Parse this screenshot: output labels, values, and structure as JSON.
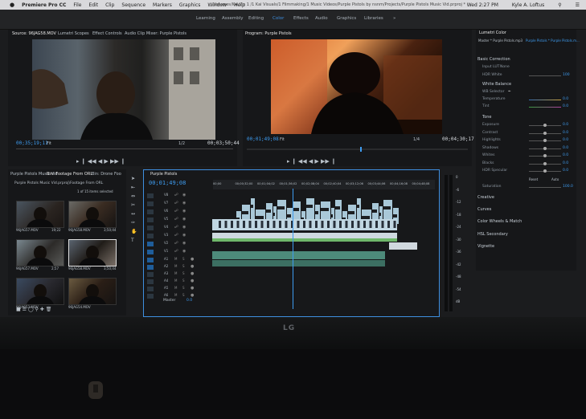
{
  "menubar": {
    "apple": "",
    "app_name": "Premiere Pro CC",
    "items": [
      "File",
      "Edit",
      "Clip",
      "Sequence",
      "Markers",
      "Graphics",
      "Window",
      "Help"
    ],
    "path": "/Volumes/Kai Vis 1 /1 Kai Visuals/1 Filmmaking/1 Music Videos/Purple Pistols by nsnm/Projects/Purple Pistols Music Vid.prproj *",
    "clock": "Wed 2:27 PM",
    "user": "Kyle A. Loftus"
  },
  "workspaces": [
    {
      "label": "Learning",
      "active": false
    },
    {
      "label": "Assembly",
      "active": false
    },
    {
      "label": "Editing",
      "active": false
    },
    {
      "label": "Color",
      "active": true
    },
    {
      "label": "Effects",
      "active": false
    },
    {
      "label": "Audio",
      "active": false
    },
    {
      "label": "Graphics",
      "active": false
    },
    {
      "label": "Libraries",
      "active": false
    },
    {
      "label": "»",
      "active": false
    }
  ],
  "source_panel": {
    "tabs": [
      "Source: 96JAG58.MOV",
      "Lumetri Scopes",
      "Effect Controls",
      "Audio Clip Mixer: Purple Pistols"
    ],
    "timecode_left": "00;35;19;11",
    "fit": "Fit",
    "scale": "1/2",
    "timecode_right": "00;03;50;44"
  },
  "program_panel": {
    "title": "Program: Purple Pistols",
    "timecode_left": "00;01;49;08",
    "fit": "Fit",
    "scale": "1/4",
    "timecode_right": "00;04;30;17"
  },
  "project_panel": {
    "tabs": [
      "Purple Pistols Music Vid",
      "Bin: Footage From ORL",
      "Bin: Drone Foo"
    ],
    "path": "Purple Pistols Music Vid.prproj\\Footage From ORL",
    "count": "1 of 15 items selected",
    "clips": [
      {
        "name": "96JAG57.MOV",
        "dur": "19;22"
      },
      {
        "name": "96JAG58.MOV",
        "dur": "3;50;44"
      },
      {
        "name": "96JAG57.MOV",
        "dur": "2;57"
      },
      {
        "name": "96JAG58.MOV",
        "dur": "3;50;44"
      },
      {
        "name": "96JAG53.MOV",
        "dur": ""
      },
      {
        "name": "96JAG54.MOV",
        "dur": ""
      }
    ]
  },
  "timeline": {
    "title": "Purple Pistols",
    "timecode": "00;01;49;08",
    "ruler": [
      "00;00",
      "00;00;32;00",
      "00;01;04;02",
      "00;01;36;02",
      "00;02;08;04",
      "00;02;40;04",
      "00;03;12;06",
      "00;03;44;06",
      "00;04;16;08",
      "00;04;48;08"
    ],
    "video_tracks": [
      "V8",
      "V7",
      "V6",
      "V5",
      "V4",
      "V3",
      "V2",
      "V1"
    ],
    "audio_tracks": [
      "A1",
      "A2",
      "A3",
      "A4",
      "A5",
      "A6"
    ],
    "master": "Master",
    "master_value": "0.0"
  },
  "meter_ticks": [
    "0",
    "-6",
    "-12",
    "-18",
    "-24",
    "-30",
    "-36",
    "-42",
    "-48",
    "-54",
    "dB"
  ],
  "lumetri": {
    "title": "Lumetri Color",
    "clip": "Master * Purple Pistols.mp3",
    "clip2": "Purple Pistols * Purple Pistols.m...",
    "basic": "Basic Correction",
    "input_lut": "Input LUT",
    "input_lut_val": "None",
    "hdr_white": "HDR White",
    "hdr_white_val": "100",
    "white_balance": "White Balance",
    "wb_selector": "WB Selector",
    "temperature": "Temperature",
    "temperature_val": "0.0",
    "tint": "Tint",
    "tint_val": "0.0",
    "tone": "Tone",
    "tone_rows": [
      {
        "label": "Exposure",
        "val": "0.0"
      },
      {
        "label": "Contrast",
        "val": "0.0"
      },
      {
        "label": "Highlights",
        "val": "0.0"
      },
      {
        "label": "Shadows",
        "val": "0.0"
      },
      {
        "label": "Whites",
        "val": "0.0"
      },
      {
        "label": "Blacks",
        "val": "0.0"
      },
      {
        "label": "HDR Specular",
        "val": "0.0"
      }
    ],
    "reset": "Reset",
    "auto": "Auto",
    "saturation": "Saturation",
    "saturation_val": "100.0",
    "sections": [
      "Creative",
      "Curves",
      "Color Wheels & Match",
      "HSL Secondary",
      "Vignette"
    ]
  },
  "bezel_logo": "LG",
  "colors": {
    "accent": "#3e9cf0",
    "panel": "#161719",
    "frame": "#1b1c1e"
  }
}
